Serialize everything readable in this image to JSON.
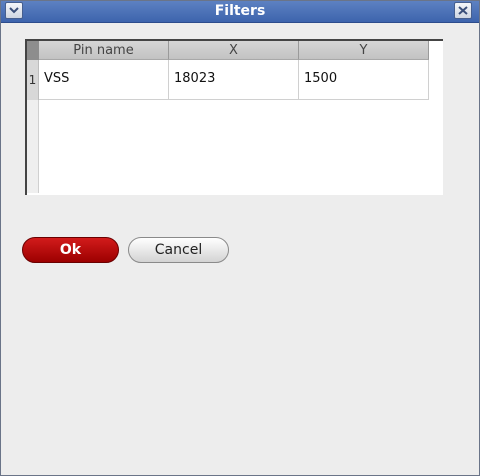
{
  "window": {
    "title": "Filters",
    "menu_icon": "chevron-down-icon",
    "close_icon": "close-icon"
  },
  "table": {
    "columns": [
      "Pin name",
      "X",
      "Y"
    ],
    "rows": [
      {
        "index": "1",
        "pin_name": "VSS",
        "x": "18023",
        "y": "1500"
      }
    ]
  },
  "buttons": {
    "ok_label": "Ok",
    "cancel_label": "Cancel"
  },
  "colors": {
    "titlebar": "#4a70b8",
    "ok_button": "#c00000"
  }
}
